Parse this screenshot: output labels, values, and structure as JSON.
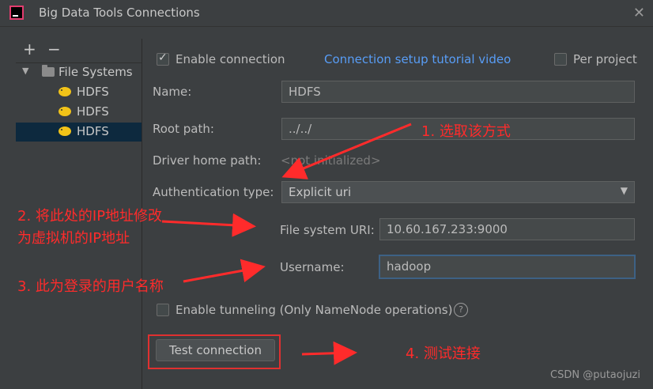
{
  "window": {
    "title": "Big Data Tools Connections",
    "close_icon": "close-icon"
  },
  "sidebar": {
    "add_label": "+",
    "remove_label": "−",
    "group_label": "File Systems",
    "items": [
      {
        "label": "HDFS",
        "selected": false
      },
      {
        "label": "HDFS",
        "selected": false
      },
      {
        "label": "HDFS",
        "selected": true
      }
    ]
  },
  "form": {
    "enable_connection": {
      "label": "Enable connection",
      "checked": true
    },
    "tutorial_link": "Connection setup tutorial video",
    "per_project": {
      "label": "Per project",
      "checked": false
    },
    "name": {
      "label": "Name:",
      "value": "HDFS"
    },
    "root_path": {
      "label": "Root path:",
      "value": "../../"
    },
    "driver_home": {
      "label": "Driver home path:",
      "value": "<not initialized>"
    },
    "auth_type": {
      "label": "Authentication type:",
      "value": "Explicit uri"
    },
    "fs_uri": {
      "label": "File system URI:",
      "value": "10.60.167.233:9000"
    },
    "username": {
      "label": "Username:",
      "value": "hadoop"
    },
    "tunneling": {
      "label": "Enable tunneling (Only NameNode operations)",
      "checked": false
    },
    "help_icon": "?",
    "test_button": "Test connection"
  },
  "annotations": {
    "a1": "1. 选取该方式",
    "a2_line1": "2. 将此处的IP地址修改",
    "a2_line2": "为虚拟机的IP地址",
    "a3": "3. 此为登录的用户名称",
    "a4": "4. 测试连接",
    "color": "#ff2b2b"
  },
  "watermark": "CSDN @putaojuzi"
}
